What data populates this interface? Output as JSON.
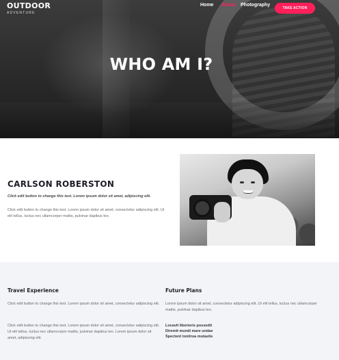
{
  "brand": {
    "line1": "OUTDOOR",
    "line2": "ADVENTURE"
  },
  "nav": {
    "items": [
      "Home",
      "About",
      "Photography"
    ],
    "active": "About",
    "cta": "TAKE ACTION",
    "active_color": "#ff1f5a"
  },
  "hero": {
    "title": "WHO AM I?"
  },
  "about": {
    "name": "CARLSON ROBERSTON",
    "tagline": "Click edit button to change this text. Lorem ipsum dolor sit amet, adipiscing elit.",
    "body": "Click edit button to change this text. Lorem ipsum dolor sit amet, consectetur adipiscing elit. Ut elit tellus, luctus nec ullamcorper mattis, pulvinar dapibus leo."
  },
  "travel": {
    "title": "Travel Experience",
    "para1": "Click edit button to change this text. Lorem ipsum dolor sit amet, consectetur adipiscing elit.",
    "para2": "Click edit button to change this text. Lorem ipsum dolor sit amet, consectetur adipiscing elit. Ut elit tellus, luctus nec ullamcorper mattis, pulvinar dapibus leo. Lorem ipsum dolor sit amet, adipiscing elit."
  },
  "future": {
    "title": "Future Plans",
    "para": "Lorem ipsum dolor sit amet, consectetur adipiscing elit. Ut elit tellus, luctus nec ullamcorper mattis, pulvinar dapibus leo.",
    "list": [
      "Locavit liberioris possedit",
      "Diremit mundi mare undae",
      "Spectent tonitrua mutastis"
    ]
  }
}
